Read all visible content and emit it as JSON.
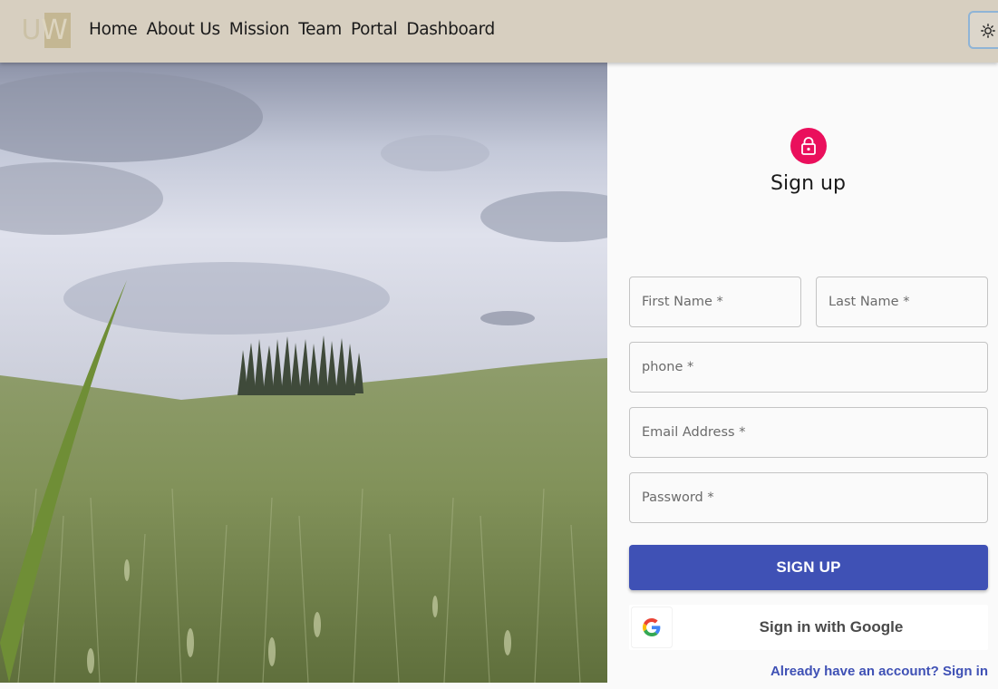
{
  "nav": {
    "logo_u": "U",
    "logo_w": "W",
    "links": [
      "Home",
      "About Us",
      "Mission",
      "Team",
      "Portal",
      "Dashboard"
    ],
    "theme_icon": "sun-icon"
  },
  "hero": {
    "image": "landscape-wheat-field-with-cypress-trees"
  },
  "form": {
    "icon": "lock-icon",
    "title": "Sign up",
    "first_name_placeholder": "First Name *",
    "last_name_placeholder": "Last Name *",
    "phone_placeholder": "phone *",
    "email_placeholder": "Email Address *",
    "password_placeholder": "Password *",
    "submit_label": "SIGN UP",
    "google_label": "Sign in with Google",
    "signin_link": "Already have an account? Sign in"
  },
  "colors": {
    "nav_bg": "#d7cfc0",
    "accent": "#3f51b5",
    "avatar": "#ea0f5c"
  }
}
